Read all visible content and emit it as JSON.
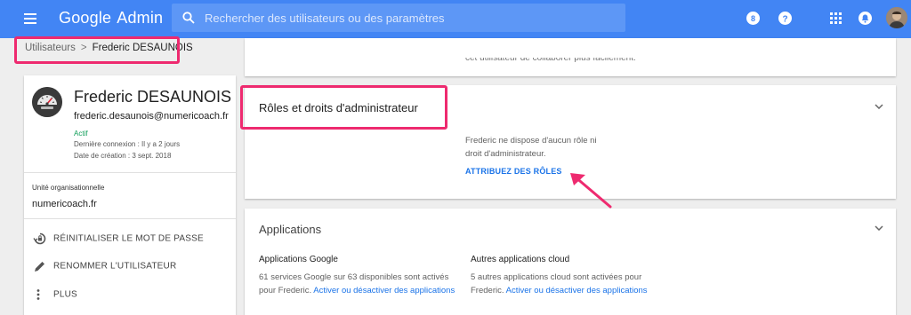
{
  "topbar": {
    "logo_google": "Google",
    "logo_admin": "Admin",
    "search_placeholder": "Rechercher des utilisateurs ou des paramètres"
  },
  "breadcrumb": {
    "parent": "Utilisateurs",
    "separator": ">",
    "current": "Frederic DESAUNOIS"
  },
  "user": {
    "name": "Frederic DESAUNOIS",
    "email": "frederic.desaunois@numericoach.fr",
    "status": "Actif",
    "last_login": "Dernière connexion : Il y a 2 jours",
    "created": "Date de création : 3 sept. 2018",
    "org_unit_label": "Unité organisationnelle",
    "org_unit_value": "numericoach.fr"
  },
  "actions": {
    "reset_password": "RÉINITIALISER LE MOT DE PASSE",
    "rename": "RENOMMER L'UTILISATEUR",
    "more": "PLUS"
  },
  "top_card": {
    "partial_text": "cet utilisateur de collaborer plus facilement."
  },
  "roles": {
    "title": "Rôles et droits d'administrateur",
    "description": "Frederic ne dispose d'aucun rôle ni droit d'administrateur.",
    "link": "ATTRIBUEZ DES RÔLES"
  },
  "apps": {
    "title": "Applications",
    "google_title": "Applications Google",
    "google_text": "61 services Google sur 63 disponibles sont activés pour Frederic.",
    "google_link": "Activer ou désactiver des applications",
    "cloud_title": "Autres applications cloud",
    "cloud_text": "5 autres applications cloud sont activées pour Frederic.",
    "cloud_link": "Activer ou désactiver des applications"
  },
  "colors": {
    "topbar": "#4285f4",
    "highlight": "#ee2a6f",
    "link": "#1a73e8",
    "active_status": "#0f9d58"
  }
}
